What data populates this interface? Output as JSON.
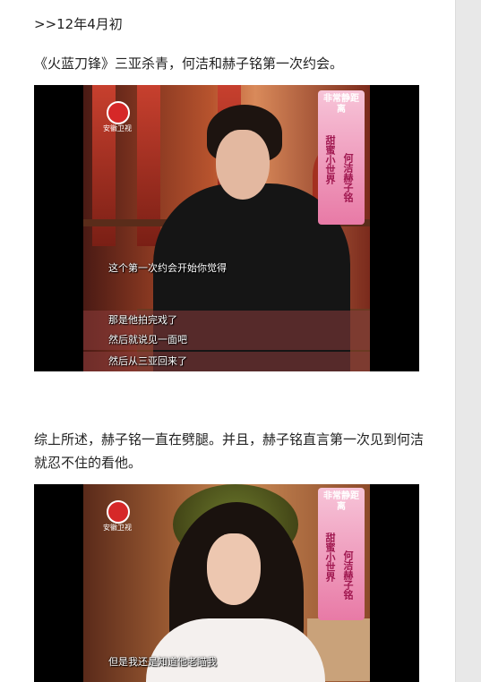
{
  "article": {
    "date_line": ">>12年4月初",
    "paragraph_1": "《火蓝刀锋》三亚杀青，何洁和赫子铭第一次约会。",
    "paragraph_2": "综上所述，赫子铭一直在劈腿。并且，赫子铭直言第一次见到何洁就忍不住的看他。"
  },
  "frame_1": {
    "logo_text": "安徽卫视",
    "banner_title": "非常静距离",
    "banner_col_left": "甜蜜小世界",
    "banner_col_right": "何洁赫子铭",
    "subtitles": [
      "这个第一次约会开始你觉得",
      "那是他拍完戏了",
      "然后就说见一面吧",
      "然后从三亚回来了"
    ]
  },
  "frame_2": {
    "logo_text": "安徽卫视",
    "banner_title": "非常静距离",
    "banner_col_left": "甜蜜小世界",
    "banner_col_right": "何洁赫子铭",
    "subtitles": [
      "但是我还是知道他老瞄我"
    ]
  },
  "colors": {
    "logo_red": "#d62828",
    "banner_pink": "#e87aa6",
    "page_bg": "#ffffff"
  }
}
